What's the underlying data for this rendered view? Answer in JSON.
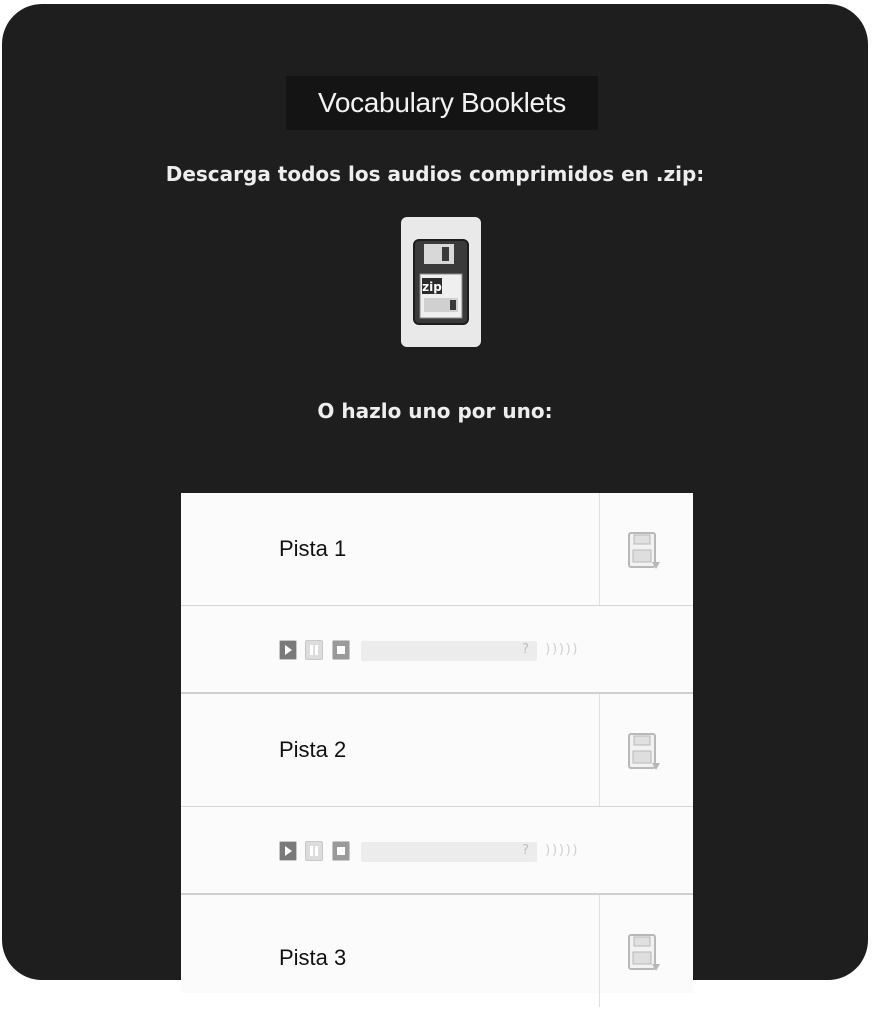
{
  "page": {
    "title": "Vocabulary Booklets",
    "download_all_label": "Descarga todos los audios comprimidos en .zip:",
    "one_by_one_label": "O hazlo uno por uno:"
  },
  "zip_icon": {
    "icon": "zip-floppy-icon",
    "text": "zip"
  },
  "tracks": [
    {
      "name": "Pista 1",
      "download_icon": "download-floppy-icon",
      "player": {
        "time": "?",
        "volume": ")))))"
      }
    },
    {
      "name": "Pista 2",
      "download_icon": "download-floppy-icon",
      "player": {
        "time": "?",
        "volume": ")))))"
      }
    },
    {
      "name": "Pista 3",
      "download_icon": "download-floppy-icon"
    }
  ],
  "colors": {
    "background": "#1f1e1e",
    "title_bar": "#141414",
    "panel": "#fbfbfb"
  }
}
